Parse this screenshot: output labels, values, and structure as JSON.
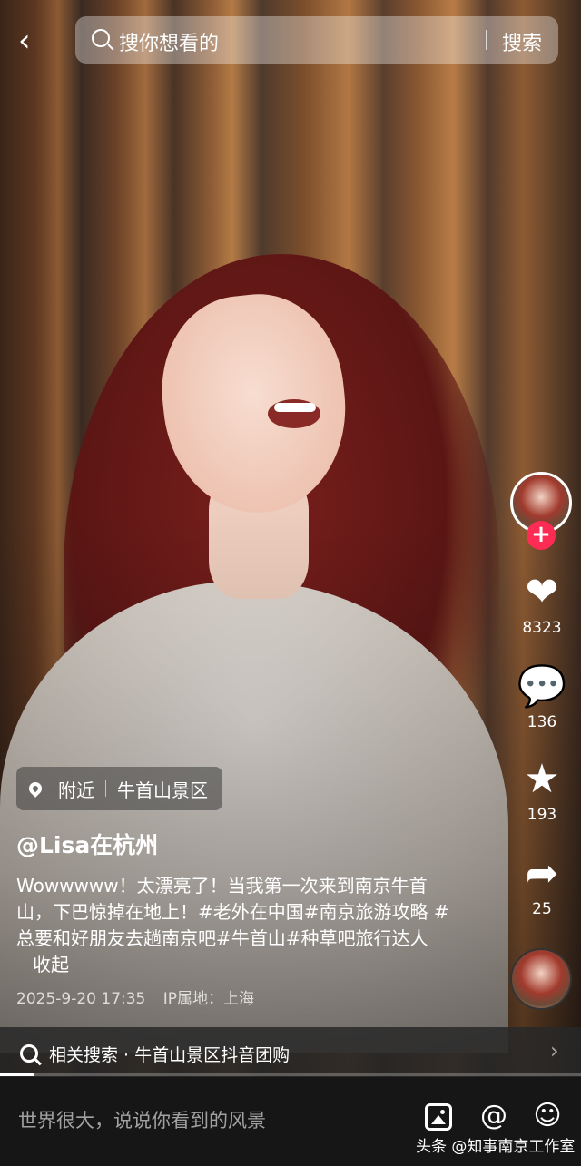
{
  "search": {
    "placeholder": "搜你想看的",
    "button": "搜索"
  },
  "creator": {
    "handle": "@Lisa在杭州",
    "location_nearby": "附近",
    "location_name": "牛首山景区"
  },
  "caption": {
    "text": "Wowwwww！太漂亮了！当我第一次来到南京牛首山，下巴惊掉在地上！#老外在中国#南京旅游攻略 #总要和好朋友去趟南京吧#牛首山#种草吧旅行达人",
    "collapse_label": "收起",
    "datetime": "2025-9-20 17:35",
    "ip_location": "IP属地：上海"
  },
  "actions": {
    "likes": "8323",
    "comments": "136",
    "favorites": "193",
    "shares": "25"
  },
  "related": {
    "label": "相关搜索 · 牛首山景区抖音团购"
  },
  "progress": 0.06,
  "bottom": {
    "comment_placeholder": "世界很大，说说你看到的风景",
    "watermark": "头条 @知事南京工作室"
  },
  "colors": {
    "accent": "#fe2c55",
    "bottom_bar": "#161616"
  },
  "icons": [
    "back-icon",
    "search-icon",
    "location-pin-icon",
    "heart-icon",
    "comment-icon",
    "star-icon",
    "share-icon",
    "image-icon",
    "at-icon",
    "emoji-icon",
    "chevron-right-icon",
    "plus-icon"
  ]
}
